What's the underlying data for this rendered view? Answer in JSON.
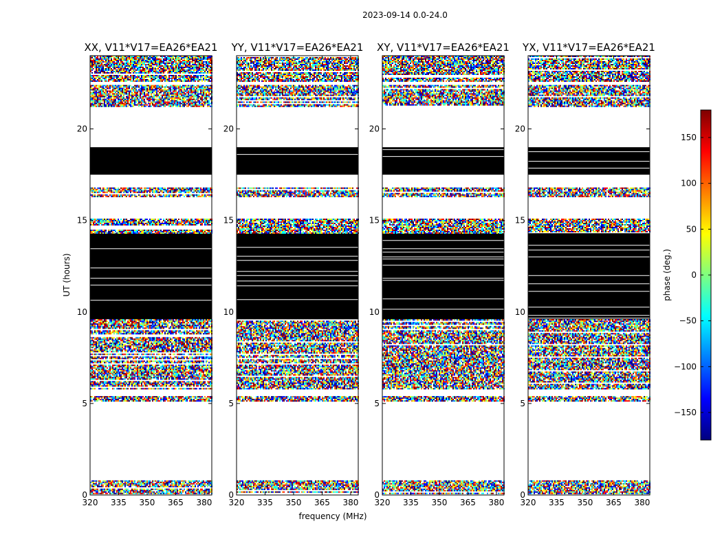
{
  "figure": {
    "suptitle": "2023-09-14 0.0-24.0",
    "ylabel": "UT (hours)",
    "xlabel": "frequency (MHz)"
  },
  "colorbar": {
    "label": "phase (deg.)",
    "range": [
      -180,
      180
    ],
    "ticks": [
      150,
      100,
      50,
      0,
      -50,
      -100,
      -150
    ],
    "tick_labels": [
      "150",
      "100",
      "50",
      "0",
      "−50",
      "−100",
      "−150"
    ],
    "colormap": "jet",
    "colors": [
      "#00007f",
      "#0000ff",
      "#007fff",
      "#00ffff",
      "#7fff7f",
      "#ffff00",
      "#ff7f00",
      "#ff0000",
      "#7f0000"
    ]
  },
  "chart_data": [
    {
      "type": "heatmap",
      "title": "XX, V11*V17=EA26*EA21",
      "x_ticks": [
        "320",
        "335",
        "350",
        "365",
        "380"
      ],
      "y_ticks": [
        "0",
        "5",
        "10",
        "15",
        "20"
      ],
      "xlim": [
        320,
        384
      ],
      "ylim": [
        0,
        24
      ],
      "scatter_bands": [
        [
          0.05,
          0.8
        ],
        [
          5.15,
          5.4
        ],
        [
          5.8,
          9.6
        ],
        [
          14.3,
          15.1
        ],
        [
          16.3,
          16.8
        ],
        [
          21.2,
          22.4
        ],
        [
          22.6,
          24
        ]
      ],
      "flagged_white_bands": [
        [
          0.8,
          5.15
        ],
        [
          5.4,
          5.8
        ],
        [
          16.8,
          17.5
        ],
        [
          19.0,
          21.2
        ],
        [
          15.1,
          16.3
        ],
        [
          22.4,
          22.6
        ]
      ],
      "black_bands": [
        [
          9.6,
          14.3
        ],
        [
          17.5,
          19.0
        ]
      ]
    },
    {
      "type": "heatmap",
      "title": "YY, V11*V17=EA26*EA21",
      "x_ticks": [
        "320",
        "335",
        "350",
        "365",
        "380"
      ],
      "y_ticks": [
        "0",
        "5",
        "10",
        "15",
        "20"
      ],
      "xlim": [
        320,
        384
      ],
      "ylim": [
        0,
        24
      ],
      "scatter_bands": [
        [
          0.05,
          0.8
        ],
        [
          5.15,
          5.4
        ],
        [
          5.8,
          9.6
        ],
        [
          14.3,
          15.1
        ],
        [
          16.3,
          16.8
        ],
        [
          21.2,
          22.4
        ],
        [
          22.6,
          24
        ]
      ],
      "flagged_white_bands": [
        [
          0.8,
          5.15
        ],
        [
          5.4,
          5.8
        ],
        [
          16.8,
          17.5
        ],
        [
          19.0,
          21.2
        ],
        [
          15.1,
          16.3
        ],
        [
          22.4,
          22.6
        ]
      ],
      "black_bands": [
        [
          9.6,
          14.3
        ],
        [
          17.5,
          19.0
        ]
      ]
    },
    {
      "type": "heatmap",
      "title": "XY, V11*V17=EA26*EA21",
      "x_ticks": [
        "320",
        "335",
        "350",
        "365",
        "380"
      ],
      "y_ticks": [
        "0",
        "5",
        "10",
        "15",
        "20"
      ],
      "xlim": [
        320,
        384
      ],
      "ylim": [
        0,
        24
      ],
      "scatter_bands": [
        [
          0.05,
          0.8
        ],
        [
          5.15,
          5.4
        ],
        [
          5.8,
          9.6
        ],
        [
          14.3,
          15.1
        ],
        [
          16.3,
          16.8
        ],
        [
          21.2,
          22.4
        ],
        [
          22.6,
          24
        ]
      ],
      "flagged_white_bands": [
        [
          0.8,
          5.15
        ],
        [
          5.4,
          5.8
        ],
        [
          16.8,
          17.5
        ],
        [
          19.0,
          21.2
        ],
        [
          15.1,
          16.3
        ],
        [
          22.4,
          22.6
        ]
      ],
      "black_bands": [
        [
          9.6,
          14.3
        ],
        [
          17.5,
          19.0
        ]
      ]
    },
    {
      "type": "heatmap",
      "title": "YX, V11*V17=EA26*EA21",
      "x_ticks": [
        "320",
        "335",
        "350",
        "365",
        "380"
      ],
      "y_ticks": [
        "0",
        "5",
        "10",
        "15",
        "20"
      ],
      "xlim": [
        320,
        384
      ],
      "ylim": [
        0,
        24
      ],
      "scatter_bands": [
        [
          0.05,
          0.8
        ],
        [
          5.15,
          5.4
        ],
        [
          5.8,
          9.6
        ],
        [
          14.3,
          15.1
        ],
        [
          16.3,
          16.8
        ],
        [
          21.2,
          22.4
        ],
        [
          22.6,
          24
        ]
      ],
      "flagged_white_bands": [
        [
          0.8,
          5.15
        ],
        [
          5.4,
          5.8
        ],
        [
          16.8,
          17.5
        ],
        [
          19.0,
          21.2
        ],
        [
          15.1,
          16.3
        ],
        [
          22.4,
          22.6
        ]
      ],
      "black_bands": [
        [
          9.6,
          14.3
        ],
        [
          17.5,
          19.0
        ]
      ]
    }
  ]
}
